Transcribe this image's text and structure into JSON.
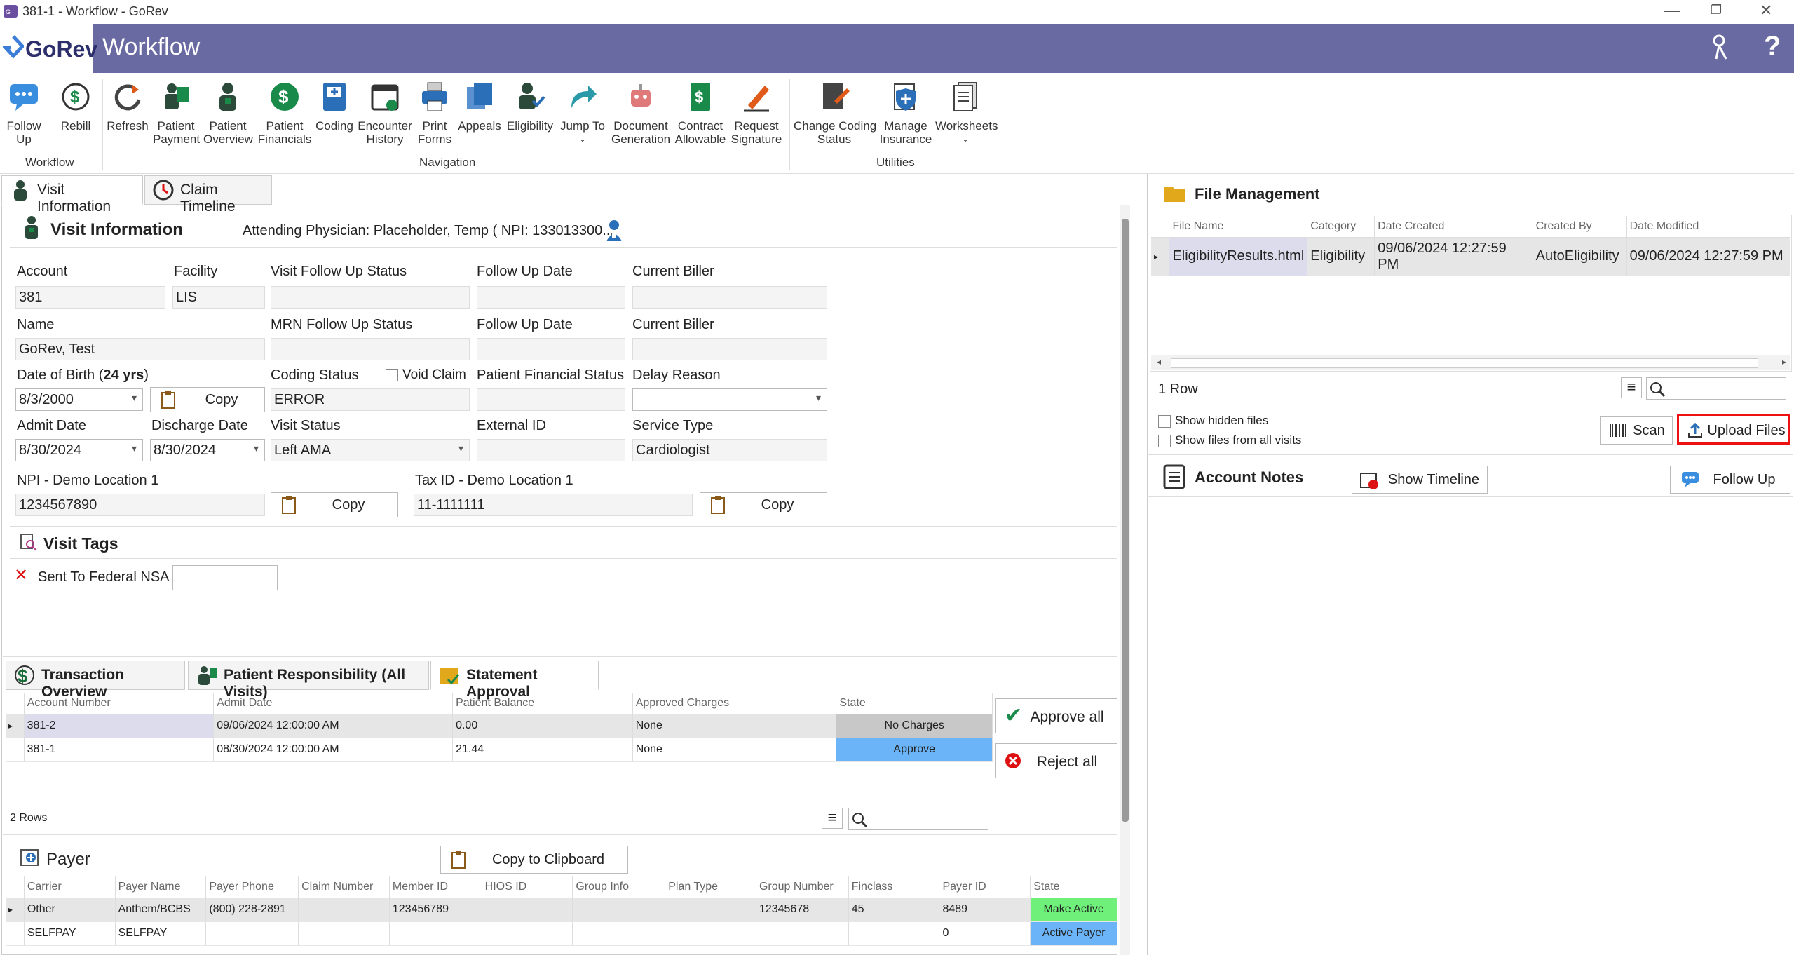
{
  "window": {
    "title": "381-1 - Workflow - GoRev",
    "minimize": "—",
    "maximize": "❐",
    "close": "✕"
  },
  "app": {
    "logo_text": "GoRev",
    "title": "Workflow"
  },
  "ribbon": {
    "buttons": [
      {
        "label": "Follow\nUp"
      },
      {
        "label": "Rebill"
      },
      {
        "label": "Refresh"
      },
      {
        "label": "Patient\nPayment"
      },
      {
        "label": "Patient\nOverview"
      },
      {
        "label": "Patient\nFinancials"
      },
      {
        "label": "Coding"
      },
      {
        "label": "Encounter\nHistory"
      },
      {
        "label": "Print\nForms"
      },
      {
        "label": "Appeals"
      },
      {
        "label": "Eligibility"
      },
      {
        "label": "Jump To"
      },
      {
        "label": "Document\nGeneration"
      },
      {
        "label": "Contract\nAllowable"
      },
      {
        "label": "Request\nSignature"
      },
      {
        "label": "Change Coding\nStatus"
      },
      {
        "label": "Manage\nInsurance"
      },
      {
        "label": "Worksheets"
      }
    ],
    "groups": {
      "workflow": "Workflow",
      "navigation": "Navigation",
      "utilities": "Utilities"
    }
  },
  "top_tabs": {
    "visit_info": "Visit Information",
    "claim_timeline": "Claim Timeline"
  },
  "visit": {
    "header": "Visit Information",
    "attending": "Attending Physician: Placeholder, Temp ( NPI: 133013300...",
    "labels": {
      "account": "Account",
      "facility": "Facility",
      "visit_followup_status": "Visit Follow Up Status",
      "followup_date": "Follow Up Date",
      "current_biller": "Current Biller",
      "name": "Name",
      "mrn_followup_status": "MRN Follow Up Status",
      "followup_date2": "Follow Up Date",
      "current_biller2": "Current Biller",
      "dob": "Date of Birth (",
      "dob_age": "24 yrs",
      "dob_close": ")",
      "coding_status": "Coding Status",
      "void_claim": "Void Claim",
      "patient_fin_status": "Patient Financial Status",
      "delay_reason": "Delay Reason",
      "admit_date": "Admit Date",
      "discharge_date": "Discharge Date",
      "visit_status": "Visit Status",
      "external_id": "External ID",
      "service_type": "Service Type",
      "npi": "NPI - Demo Location 1",
      "tax_id": "Tax ID - Demo Location 1"
    },
    "values": {
      "account": "381",
      "facility": "LIS",
      "name": "GoRev, Test",
      "dob": "8/3/2000",
      "coding_status": "ERROR",
      "admit_date": "8/30/2024",
      "discharge_date": "8/30/2024",
      "visit_status": "Left AMA",
      "service_type": "Cardiologist",
      "npi": "1234567890",
      "tax_id": "11-1111111"
    },
    "copy_label": "Copy"
  },
  "visit_tags": {
    "header": "Visit Tags",
    "tag": "Sent To Federal NSA"
  },
  "bottom_tabs": {
    "transaction": "Transaction Overview",
    "responsibility": "Patient Responsibility (All Visits)",
    "statement": "Statement Approval"
  },
  "statement": {
    "columns": [
      "Account Number",
      "Admit Date",
      "Patient Balance",
      "Approved Charges",
      "State"
    ],
    "rows": [
      {
        "account": "381-2",
        "admit": "09/06/2024 12:00:00 AM",
        "balance": "0.00",
        "approved": "None",
        "state": "No Charges"
      },
      {
        "account": "381-1",
        "admit": "08/30/2024 12:00:00 AM",
        "balance": "21.44",
        "approved": "None",
        "state": "Approve"
      }
    ],
    "row_count": "2 Rows",
    "approve_all": "Approve all",
    "reject_all": "Reject all"
  },
  "payer": {
    "header": "Payer",
    "copy_clipboard": "Copy to Clipboard",
    "columns": [
      "Carrier",
      "Payer Name",
      "Payer Phone",
      "Claim Number",
      "Member ID",
      "HIOS ID",
      "Group Info",
      "Plan Type",
      "Group Number",
      "Finclass",
      "Payer ID",
      "State"
    ],
    "rows": [
      {
        "carrier": "Other",
        "payer_name": "Anthem/BCBS",
        "phone": "(800) 228-2891",
        "claim": "",
        "member": "123456789",
        "hios": "",
        "group_info": "",
        "plan": "",
        "group_number": "12345678",
        "finclass": "45",
        "payer_id": "8489",
        "state": "Make Active"
      },
      {
        "carrier": "SELFPAY",
        "payer_name": "SELFPAY",
        "phone": "",
        "claim": "",
        "member": "",
        "hios": "",
        "group_info": "",
        "plan": "",
        "group_number": "",
        "finclass": "",
        "payer_id": "0",
        "state": "Active Payer"
      }
    ]
  },
  "files": {
    "header": "File Management",
    "columns": [
      "File Name",
      "Category",
      "Date Created",
      "Created By",
      "Date Modified"
    ],
    "rows": [
      {
        "name": "EligibilityResults.html",
        "category": "Eligibility",
        "created": "09/06/2024 12:27:59 PM",
        "by": "AutoEligibility",
        "modified": "09/06/2024 12:27:59 PM"
      }
    ],
    "row_count": "1 Row",
    "show_hidden": "Show hidden files",
    "show_all_visits": "Show files from all visits",
    "scan": "Scan",
    "upload": "Upload Files"
  },
  "notes": {
    "header": "Account Notes",
    "show_timeline": "Show Timeline",
    "follow_up": "Follow Up"
  },
  "colors": {
    "appbar": "#6a6aa2",
    "approve": "#6ab4f7",
    "no_charges": "#c8c8c8",
    "make_active": "#6ff07a",
    "active_payer": "#6ab4f7",
    "highlight": "#e11"
  }
}
